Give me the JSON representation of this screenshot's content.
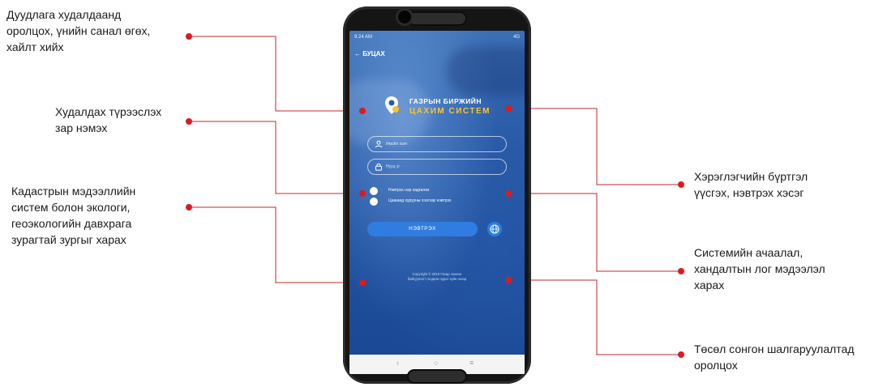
{
  "callouts": {
    "left1": "Дуудлага худалдаанд\nоролцох, үнийн санал өгөх,\nхайлт хийх",
    "left2": "Худалдах түрээслэх\nзар нэмэх",
    "left3": "Кадастрын мэдээллийн\nсистем болон экологи,\nгеоэкологийн давхрага\nзурагтай зургыг харах",
    "right1": "Хэрэглэгчийн бүртгэл\nүүсгэх, нэвтрэх хэсэг",
    "right2": "Системийн ачаалал,\nхандалтын лог мэдээлэл\nхарах",
    "right3": "Төсөл сонгон шалгаруулалтад\nоролцох"
  },
  "phone": {
    "status_time": "9:24 AM",
    "status_right": "4G",
    "back_label": "← БУЦАХ",
    "logo_line1": "ГАЗРЫН БИРЖИЙН",
    "logo_line2": "ЦАХИМ СИСТЕМ",
    "email_placeholder": "Имэйл хаяг",
    "password_placeholder": "Нууц үг",
    "remember_label": "Нэвтрэх нэр хадгалах",
    "shortcut_label": "Цаашид хурууны хээгээр нэвтрэх",
    "login_label": "НЭВТРЭХ",
    "copyright": "Copyright © 2019 Газар зохион\nбайгуулалт геодези зураг зүйн газар",
    "nav_back": "‹",
    "nav_home": "○",
    "nav_menu": "≡"
  },
  "colors": {
    "marker": "#e0191f",
    "connector": "#c1272d",
    "accent_yellow": "#f5c433",
    "button_blue": "#2f7de0"
  },
  "icons": [
    "location-pin-icon",
    "user-icon",
    "lock-icon",
    "globe-icon",
    "back-arrow-icon"
  ]
}
